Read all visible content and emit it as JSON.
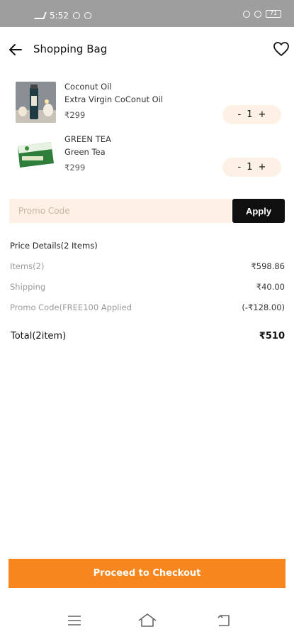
{
  "status_bar": {
    "time": "5:52",
    "battery": "71"
  },
  "header": {
    "title": "Shopping Bag",
    "back_icon": "arrow-left-icon",
    "wishlist_icon": "heart-icon"
  },
  "cart": {
    "items": [
      {
        "name": "Coconut Oil",
        "subtitle": "Extra Virgin CoConut Oil",
        "price": "₹299",
        "quantity": "1",
        "minus": "-",
        "plus": "+"
      },
      {
        "name": "GREEN TEA",
        "subtitle": "Green Tea",
        "price": "₹299",
        "quantity": "1",
        "minus": "-",
        "plus": "+"
      }
    ]
  },
  "promo": {
    "placeholder": "Promo Code",
    "apply_label": "Apply"
  },
  "price_details": {
    "title": "Price Details(2 Items)",
    "rows": [
      {
        "label": "Items(2)",
        "value": "₹598.86"
      },
      {
        "label": "Shipping",
        "value": "₹40.00"
      },
      {
        "label": "Promo Code(FREE100 Applied",
        "value": "(-₹128.00)"
      }
    ],
    "total_label": "Total(2item)",
    "total_value": "₹510"
  },
  "checkout": {
    "label": "Proceed to Checkout"
  },
  "colors": {
    "accent": "#f7861f",
    "input_bg": "#fdf1e6",
    "apply_bg": "#0f0f0f",
    "status_bar": "#9e9e9e"
  }
}
